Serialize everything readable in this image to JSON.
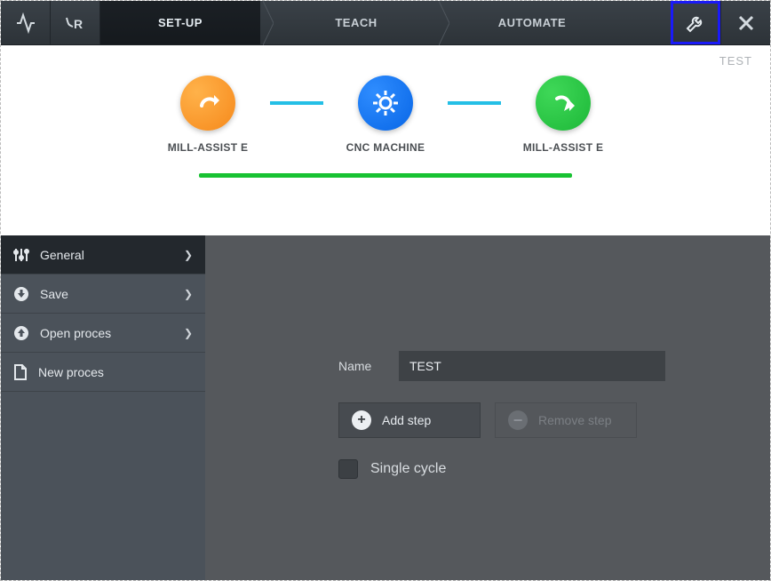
{
  "header": {
    "tabs": [
      "SET-UP",
      "TEACH",
      "AUTOMATE"
    ],
    "active_tab_index": 0
  },
  "project_name": "TEST",
  "flow": {
    "nodes": [
      {
        "label": "MILL-ASSIST E",
        "icon": "arrow-out",
        "color": "#f6891b"
      },
      {
        "label": "CNC MACHINE",
        "icon": "gear",
        "color": "#0866e6"
      },
      {
        "label": "MILL-ASSIST E",
        "icon": "arrow-in",
        "color": "#1db838"
      }
    ]
  },
  "sidebar": {
    "items": [
      {
        "icon": "sliders",
        "label": "General",
        "has_children": true,
        "active": true
      },
      {
        "icon": "download",
        "label": "Save",
        "has_children": true,
        "active": false
      },
      {
        "icon": "upload",
        "label": "Open proces",
        "has_children": true,
        "active": false
      },
      {
        "icon": "file",
        "label": "New proces",
        "has_children": false,
        "active": false
      }
    ]
  },
  "form": {
    "name_label": "Name",
    "name_value": "TEST",
    "add_step_label": "Add step",
    "remove_step_label": "Remove step",
    "remove_step_enabled": false,
    "single_cycle_label": "Single cycle",
    "single_cycle_checked": false
  }
}
